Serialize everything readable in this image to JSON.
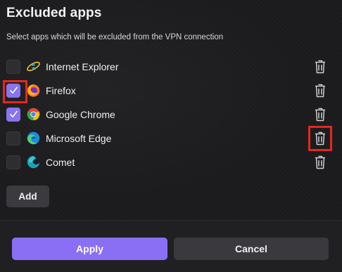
{
  "dialog": {
    "title": "Excluded apps",
    "subtitle": "Select apps which will be excluded from the VPN connection"
  },
  "apps": [
    {
      "label": "Internet Explorer",
      "checked": false,
      "icon": "internet-explorer-icon"
    },
    {
      "label": "Firefox",
      "checked": true,
      "icon": "firefox-icon"
    },
    {
      "label": "Google Chrome",
      "checked": true,
      "icon": "chrome-icon"
    },
    {
      "label": "Microsoft Edge",
      "checked": false,
      "icon": "edge-icon"
    },
    {
      "label": "Comet",
      "checked": false,
      "icon": "comet-icon"
    }
  ],
  "buttons": {
    "add": "Add",
    "apply": "Apply",
    "cancel": "Cancel"
  },
  "colors": {
    "accent": "#8a6ff5",
    "highlight": "#e5271f",
    "background": "#1b1b1d"
  }
}
